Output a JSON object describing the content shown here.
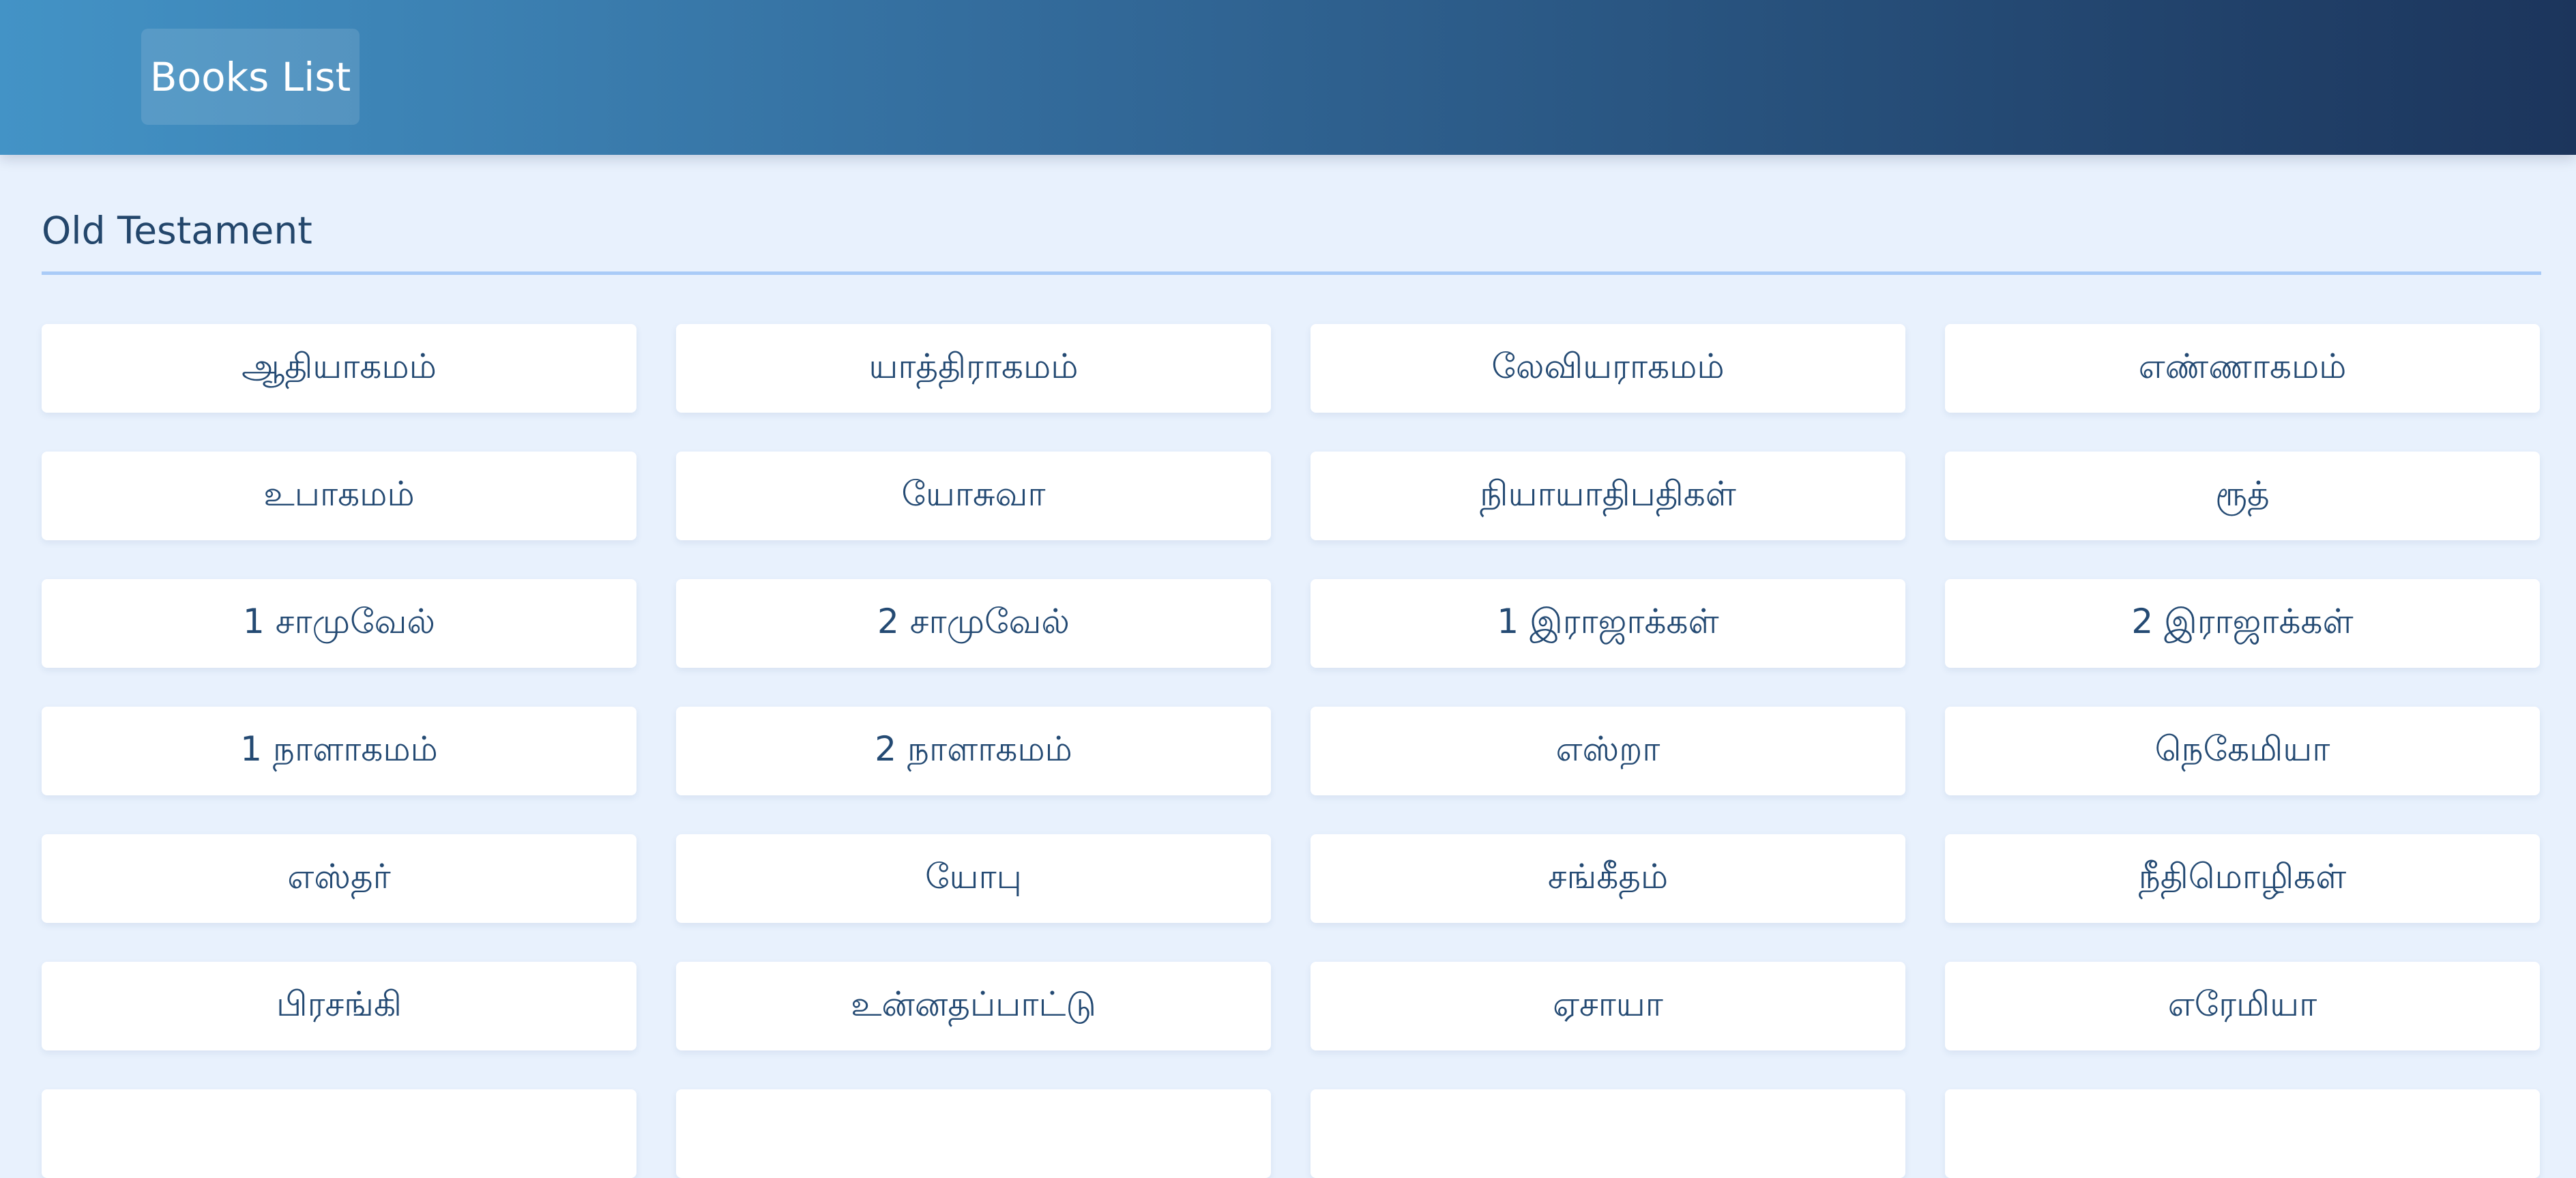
{
  "header": {
    "nav_label": "Books List"
  },
  "section": {
    "title": "Old Testament"
  },
  "books": [
    "ஆதியாகமம்",
    "யாத்திராகமம்",
    "லேவியராகமம்",
    "எண்ணாகமம்",
    "உபாகமம்",
    "யோசுவா",
    "நியாயாதிபதிகள்",
    "ரூத்",
    "1 சாமுவேல்",
    "2 சாமுவேல்",
    "1 இராஜாக்கள்",
    "2 இராஜாக்கள்",
    "1 நாளாகமம்",
    "2 நாளாகமம்",
    "எஸ்றா",
    "நெகேமியா",
    "எஸ்தர்",
    "யோபு",
    "சங்கீதம்",
    "நீதிமொழிகள்",
    "பிரசங்கி",
    "உன்னதப்பாட்டு",
    "ஏசாயா",
    "எரேமியா",
    "",
    "",
    "",
    ""
  ]
}
